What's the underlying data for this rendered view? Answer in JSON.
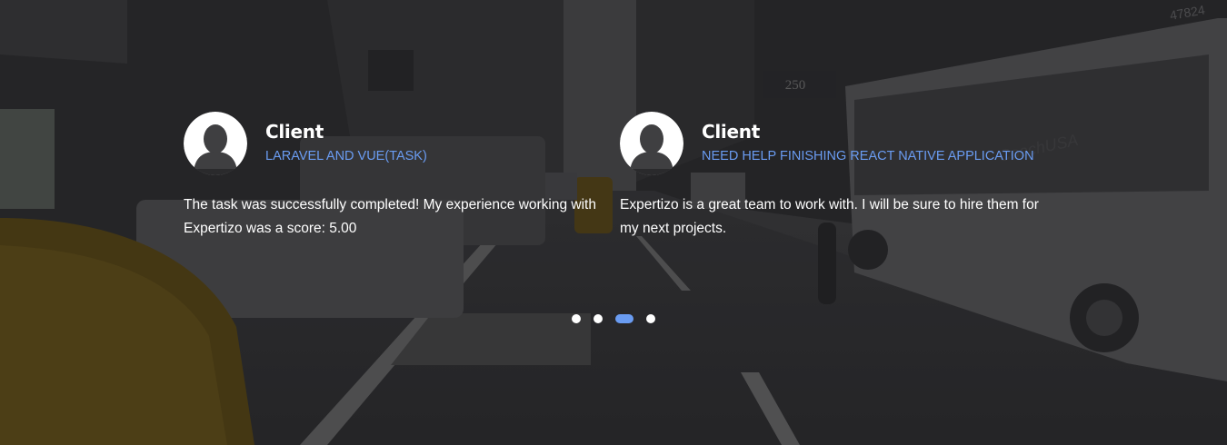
{
  "testimonials": [
    {
      "name": "Client",
      "project": "LARAVEL AND VUE(TASK)",
      "text": "The task was successfully completed! My experience working with Expertizo was a score: 5.00"
    },
    {
      "name": "Client",
      "project": "NEED HELP FINISHING REACT NATIVE APPLICATION",
      "text": "Expertizo is a great team to work with. I will be sure to hire them for my next projects."
    }
  ],
  "carousel": {
    "dot_count": 4,
    "active_index": 2
  },
  "colors": {
    "accent": "#6a9cf2",
    "text": "#ffffff",
    "overlay": "#2b2b2d"
  },
  "background": {
    "sign_address": "250",
    "bus_brand": "CoachUSA",
    "bus_number": "47824"
  }
}
